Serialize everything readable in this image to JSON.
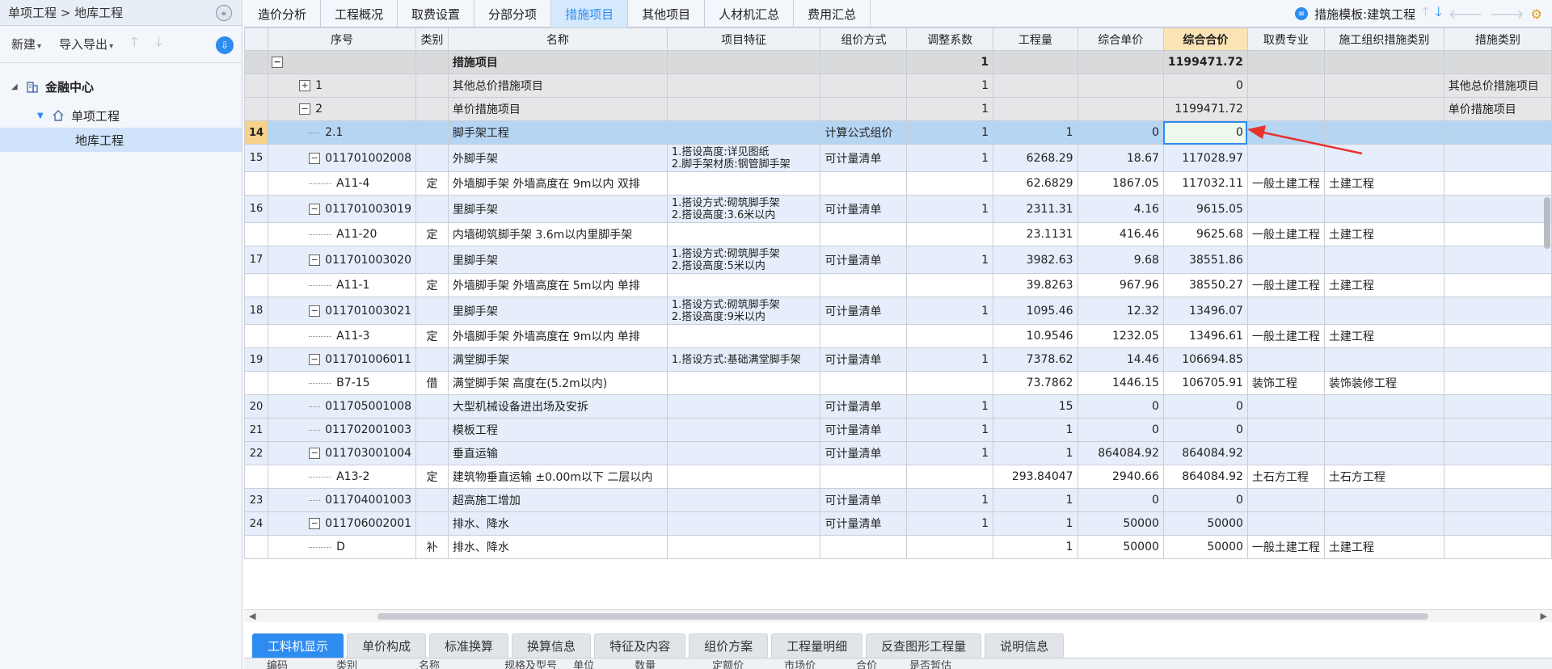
{
  "sidebar": {
    "breadcrumb": "单项工程 > 地库工程",
    "toolbar": {
      "new_label": "新建",
      "import_export_label": "导入导出"
    },
    "tree": [
      {
        "label": "金融中心",
        "level": 0
      },
      {
        "label": "单项工程",
        "level": 1
      },
      {
        "label": "地库工程",
        "level": 2,
        "selected": true
      }
    ]
  },
  "tabs": [
    "造价分析",
    "工程概况",
    "取费设置",
    "分部分项",
    "措施项目",
    "其他项目",
    "人材机汇总",
    "费用汇总"
  ],
  "active_tab": "措施项目",
  "template": {
    "label": "措施模板:建筑工程"
  },
  "columns": [
    "序号",
    "类别",
    "名称",
    "项目特征",
    "组价方式",
    "调整系数",
    "工程量",
    "综合单价",
    "综合合价",
    "取费专业",
    "施工组织措施类别",
    "措施类别"
  ],
  "rows": [
    {
      "idx": "",
      "seq": "",
      "type": "",
      "name": "措施项目",
      "feature": "",
      "method": "",
      "coef": "1",
      "qty": "",
      "unit_price": "",
      "total": "1199471.72",
      "fee": "",
      "org": "",
      "cat": "",
      "kind": "lvl0",
      "marker": "minus"
    },
    {
      "idx": "",
      "seq": "1",
      "type": "",
      "name": "其他总价措施项目",
      "feature": "",
      "method": "",
      "coef": "1",
      "qty": "",
      "unit_price": "",
      "total": "0",
      "fee": "",
      "org": "",
      "cat": "其他总价措施项目",
      "kind": "lvl1",
      "marker": "plus"
    },
    {
      "idx": "",
      "seq": "2",
      "type": "",
      "name": "单价措施项目",
      "feature": "",
      "method": "",
      "coef": "1",
      "qty": "",
      "unit_price": "",
      "total": "1199471.72",
      "fee": "",
      "org": "",
      "cat": "单价措施项目",
      "kind": "lvl1",
      "marker": "minus"
    },
    {
      "idx": "14",
      "seq": "2.1",
      "type": "",
      "name": "脚手架工程",
      "feature": "",
      "method": "计算公式组价",
      "coef": "1",
      "qty": "1",
      "unit_price": "0",
      "total": "0",
      "fee": "",
      "org": "",
      "cat": "",
      "kind": "cur",
      "marker": "line"
    },
    {
      "idx": "15",
      "seq": "011701002008",
      "type": "",
      "name": "外脚手架",
      "feature": "1.搭设高度:详见图纸\n2.脚手架材质:钢管脚手架",
      "method": "可计量清单",
      "coef": "1",
      "qty": "6268.29",
      "unit_price": "18.67",
      "total": "117028.97",
      "fee": "",
      "org": "",
      "cat": "",
      "kind": "bill tall",
      "marker": "minus"
    },
    {
      "idx": "",
      "seq": "A11-4",
      "type": "定",
      "name": "外墙脚手架 外墙高度在 9m以内 双排",
      "feature": "",
      "method": "",
      "coef": "",
      "qty": "62.6829",
      "unit_price": "1867.05",
      "total": "117032.11",
      "fee": "一般土建工程",
      "org": "土建工程",
      "cat": "",
      "kind": "quota",
      "marker": "line2"
    },
    {
      "idx": "16",
      "seq": "011701003019",
      "type": "",
      "name": "里脚手架",
      "feature": "1.搭设方式:砌筑脚手架\n2.搭设高度:3.6米以内",
      "method": "可计量清单",
      "coef": "1",
      "qty": "2311.31",
      "unit_price": "4.16",
      "total": "9615.05",
      "fee": "",
      "org": "",
      "cat": "",
      "kind": "bill tall",
      "marker": "minus"
    },
    {
      "idx": "",
      "seq": "A11-20",
      "type": "定",
      "name": "内墙砌筑脚手架 3.6m以内里脚手架",
      "feature": "",
      "method": "",
      "coef": "",
      "qty": "23.1131",
      "unit_price": "416.46",
      "total": "9625.68",
      "fee": "一般土建工程",
      "org": "土建工程",
      "cat": "",
      "kind": "quota",
      "marker": "line2"
    },
    {
      "idx": "17",
      "seq": "011701003020",
      "type": "",
      "name": "里脚手架",
      "feature": "1.搭设方式:砌筑脚手架\n2.搭设高度:5米以内",
      "method": "可计量清单",
      "coef": "1",
      "qty": "3982.63",
      "unit_price": "9.68",
      "total": "38551.86",
      "fee": "",
      "org": "",
      "cat": "",
      "kind": "bill tall",
      "marker": "minus"
    },
    {
      "idx": "",
      "seq": "A11-1",
      "type": "定",
      "name": "外墙脚手架 外墙高度在 5m以内 单排",
      "feature": "",
      "method": "",
      "coef": "",
      "qty": "39.8263",
      "unit_price": "967.96",
      "total": "38550.27",
      "fee": "一般土建工程",
      "org": "土建工程",
      "cat": "",
      "kind": "quota",
      "marker": "line2"
    },
    {
      "idx": "18",
      "seq": "011701003021",
      "type": "",
      "name": "里脚手架",
      "feature": "1.搭设方式:砌筑脚手架\n2.搭设高度:9米以内",
      "method": "可计量清单",
      "coef": "1",
      "qty": "1095.46",
      "unit_price": "12.32",
      "total": "13496.07",
      "fee": "",
      "org": "",
      "cat": "",
      "kind": "bill tall",
      "marker": "minus"
    },
    {
      "idx": "",
      "seq": "A11-3",
      "type": "定",
      "name": "外墙脚手架 外墙高度在 9m以内 单排",
      "feature": "",
      "method": "",
      "coef": "",
      "qty": "10.9546",
      "unit_price": "1232.05",
      "total": "13496.61",
      "fee": "一般土建工程",
      "org": "土建工程",
      "cat": "",
      "kind": "quota",
      "marker": "line2"
    },
    {
      "idx": "19",
      "seq": "011701006011",
      "type": "",
      "name": "满堂脚手架",
      "feature": "1.搭设方式:基础满堂脚手架",
      "method": "可计量清单",
      "coef": "1",
      "qty": "7378.62",
      "unit_price": "14.46",
      "total": "106694.85",
      "fee": "",
      "org": "",
      "cat": "",
      "kind": "bill",
      "marker": "minus"
    },
    {
      "idx": "",
      "seq": "B7-15",
      "type": "借",
      "name": "满堂脚手架 高度在(5.2m以内)",
      "feature": "",
      "method": "",
      "coef": "",
      "qty": "73.7862",
      "unit_price": "1446.15",
      "total": "106705.91",
      "fee": "装饰工程",
      "org": "装饰装修工程",
      "cat": "",
      "kind": "quota",
      "marker": "line2"
    },
    {
      "idx": "20",
      "seq": "011705001008",
      "type": "",
      "name": "大型机械设备进出场及安拆",
      "feature": "",
      "method": "可计量清单",
      "coef": "1",
      "qty": "15",
      "unit_price": "0",
      "total": "0",
      "fee": "",
      "org": "",
      "cat": "",
      "kind": "bill",
      "marker": "line"
    },
    {
      "idx": "21",
      "seq": "011702001003",
      "type": "",
      "name": "模板工程",
      "feature": "",
      "method": "可计量清单",
      "coef": "1",
      "qty": "1",
      "unit_price": "0",
      "total": "0",
      "fee": "",
      "org": "",
      "cat": "",
      "kind": "bill",
      "marker": "line"
    },
    {
      "idx": "22",
      "seq": "011703001004",
      "type": "",
      "name": "垂直运输",
      "feature": "",
      "method": "可计量清单",
      "coef": "1",
      "qty": "1",
      "unit_price": "864084.92",
      "total": "864084.92",
      "fee": "",
      "org": "",
      "cat": "",
      "kind": "bill",
      "marker": "minus"
    },
    {
      "idx": "",
      "seq": "A13-2",
      "type": "定",
      "name": "建筑物垂直运输 ±0.00m以下 二层以内",
      "feature": "",
      "method": "",
      "coef": "",
      "qty": "293.84047",
      "unit_price": "2940.66",
      "total": "864084.92",
      "fee": "土石方工程",
      "org": "土石方工程",
      "cat": "",
      "kind": "quota",
      "marker": "line2"
    },
    {
      "idx": "23",
      "seq": "011704001003",
      "type": "",
      "name": "超高施工增加",
      "feature": "",
      "method": "可计量清单",
      "coef": "1",
      "qty": "1",
      "unit_price": "0",
      "total": "0",
      "fee": "",
      "org": "",
      "cat": "",
      "kind": "bill",
      "marker": "line"
    },
    {
      "idx": "24",
      "seq": "011706002001",
      "type": "",
      "name": "排水、降水",
      "feature": "",
      "method": "可计量清单",
      "coef": "1",
      "qty": "1",
      "unit_price": "50000",
      "total": "50000",
      "fee": "",
      "org": "",
      "cat": "",
      "kind": "bill",
      "marker": "minus"
    },
    {
      "idx": "",
      "seq": "D",
      "type": "补",
      "name": "排水、降水",
      "feature": "",
      "method": "",
      "coef": "",
      "qty": "1",
      "unit_price": "50000",
      "total": "50000",
      "fee": "一般土建工程",
      "org": "土建工程",
      "cat": "",
      "kind": "quota",
      "marker": "line2"
    }
  ],
  "bottom_tabs": [
    "工料机显示",
    "单价构成",
    "标准换算",
    "换算信息",
    "特征及内容",
    "组价方案",
    "工程量明细",
    "反查图形工程量",
    "说明信息"
  ],
  "bottom_active": "工料机显示",
  "bottom_columns": [
    "编码",
    "类别",
    "名称",
    "规格及型号",
    "单位",
    "数量",
    "定额价",
    "市场价",
    "合价",
    "是否暂估"
  ],
  "colors": {
    "accent": "#2d8cf0",
    "arrow": "#e8322e",
    "highlight_header": "#fce3b6"
  }
}
